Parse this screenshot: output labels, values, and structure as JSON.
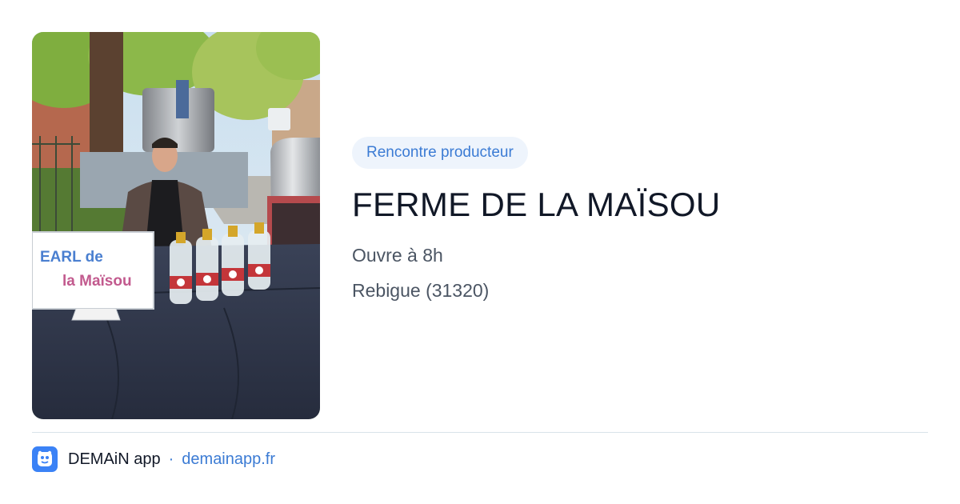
{
  "card": {
    "photo_alt": "",
    "sign_text_line1": "EARL de",
    "sign_text_line2": "la Maïsou",
    "badge": "Rencontre producteur",
    "title": "FERME DE LA MAÏSOU",
    "hours": "Ouvre à 8h",
    "location": "Rebigue (31320)"
  },
  "footer": {
    "app_name": "DEMAiN app",
    "separator": "·",
    "link": "demainapp.fr"
  },
  "colors": {
    "accent": "#3b7bd4",
    "badge_bg": "#eef4fc",
    "title": "#111827",
    "meta": "#4b5563",
    "divider": "#d9e3ea",
    "logo_bg": "#3b82f6"
  }
}
